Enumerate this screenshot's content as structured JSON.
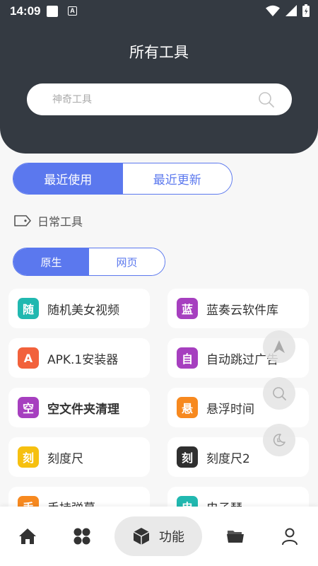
{
  "status_bar": {
    "time": "14:09",
    "notification_icon_letter": "A"
  },
  "header": {
    "title": "所有工具"
  },
  "search": {
    "placeholder": "神奇工具",
    "value": ""
  },
  "top_tabs": [
    {
      "label": "最近使用",
      "active": true
    },
    {
      "label": "最近更新",
      "active": false
    }
  ],
  "section": {
    "label": "日常工具"
  },
  "sub_tabs": [
    {
      "label": "原生",
      "active": true
    },
    {
      "label": "网页",
      "active": false
    }
  ],
  "tools": [
    {
      "icon_char": "随",
      "color": "#21b8b0",
      "label": "随机美女视频"
    },
    {
      "icon_char": "蓝",
      "color": "#a63fbf",
      "label": "蓝奏云软件库"
    },
    {
      "icon_char": "A",
      "color": "#f2613b",
      "label": "APK.1安装器"
    },
    {
      "icon_char": "自",
      "color": "#a63fbf",
      "label": "自动跳过广告"
    },
    {
      "icon_char": "空",
      "color": "#a63fbf",
      "label": "空文件夹清理"
    },
    {
      "icon_char": "悬",
      "color": "#f7891f",
      "label": "悬浮时间"
    },
    {
      "icon_char": "刻",
      "color": "#f6c010",
      "label": "刻度尺"
    },
    {
      "icon_char": "刻",
      "color": "#2f2f2f",
      "label": "刻度尺2"
    },
    {
      "icon_char": "手",
      "color": "#f7891f",
      "label": "手持弹幕"
    },
    {
      "icon_char": "电",
      "color": "#21b8b0",
      "label": "电子琴"
    }
  ],
  "floating_buttons": [
    "navigation-icon",
    "search-icon",
    "night-mode-icon"
  ],
  "nav": {
    "items": [
      "home-icon",
      "apps-grid-icon",
      "cube-icon",
      "folder-icon",
      "user-icon"
    ],
    "active_label": "功能"
  },
  "colors": {
    "header_bg": "#343a42",
    "accent": "#5b78ee",
    "page_bg": "#f7f7f7"
  }
}
